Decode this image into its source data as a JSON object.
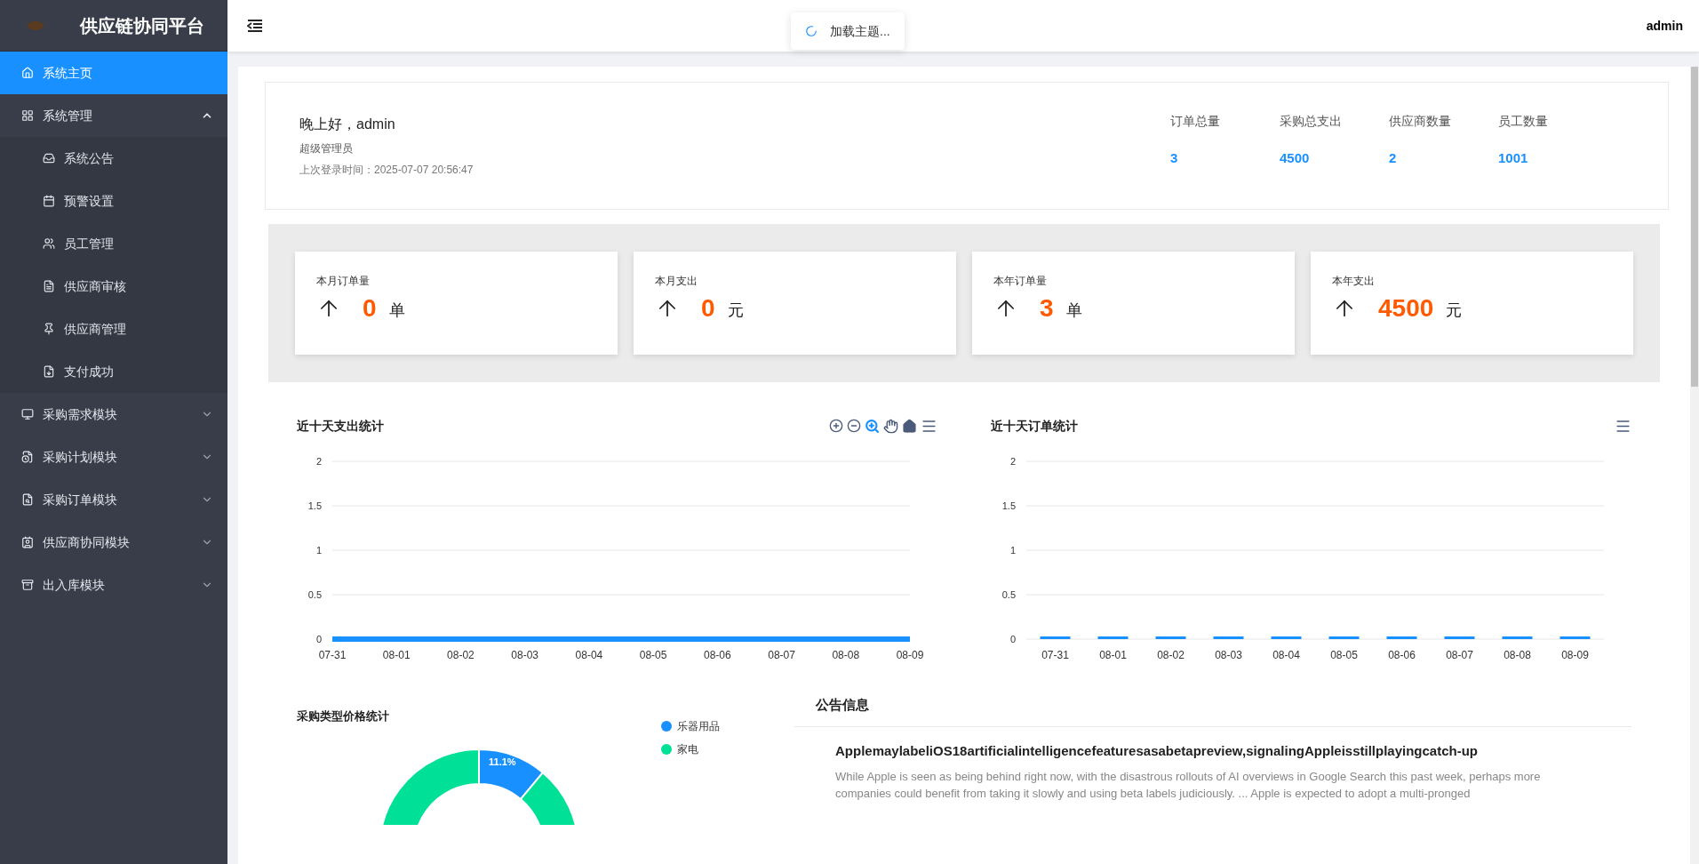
{
  "sidebar": {
    "title": "供应链协同平台",
    "items": [
      {
        "label": "系统主页",
        "kind": "item",
        "selected": true
      },
      {
        "label": "系统管理",
        "kind": "group",
        "selected": false,
        "expanded": true,
        "children": [
          {
            "label": "系统公告",
            "selected": false
          },
          {
            "label": "预警设置",
            "selected": false
          },
          {
            "label": "员工管理",
            "selected": false
          },
          {
            "label": "供应商审核",
            "selected": false
          },
          {
            "label": "供应商管理",
            "selected": false
          },
          {
            "label": "支付成功",
            "selected": false
          }
        ]
      },
      {
        "label": "采购需求模块",
        "kind": "group",
        "selected": false,
        "expanded": false
      },
      {
        "label": "采购计划模块",
        "kind": "group",
        "selected": false,
        "expanded": false
      },
      {
        "label": "采购订单模块",
        "kind": "group",
        "selected": false,
        "expanded": false
      },
      {
        "label": "供应商协同模块",
        "kind": "group",
        "selected": false,
        "expanded": false
      },
      {
        "label": "出入库模块",
        "kind": "group",
        "selected": false,
        "expanded": false
      }
    ]
  },
  "header": {
    "toast": "加载主题...",
    "user": "admin"
  },
  "welcome": {
    "greeting": "晚上好，admin",
    "role": "超级管理员",
    "last_login": "上次登录时间：2025-07-07 20:56:47",
    "stats": [
      {
        "label": "订单总量",
        "value": "3"
      },
      {
        "label": "采购总支出",
        "value": "4500"
      },
      {
        "label": "供应商数量",
        "value": "2"
      },
      {
        "label": "员工数量",
        "value": "1001"
      }
    ]
  },
  "cards": [
    {
      "label": "本月订单量",
      "value": "0",
      "unit": "单"
    },
    {
      "label": "本月支出",
      "value": "0",
      "unit": "元"
    },
    {
      "label": "本年订单量",
      "value": "3",
      "unit": "单"
    },
    {
      "label": "本年支出",
      "value": "4500",
      "unit": "元"
    }
  ],
  "expense_chart": {
    "chart_data": {
      "type": "line",
      "title": "近十天支出统计",
      "categories": [
        "07-31",
        "08-01",
        "08-02",
        "08-03",
        "08-04",
        "08-05",
        "08-06",
        "08-07",
        "08-08",
        "08-09"
      ],
      "series": [
        {
          "color": "#1890ff",
          "values": [
            0,
            0,
            0,
            0,
            0,
            0,
            0,
            0,
            0,
            0
          ]
        }
      ],
      "ylim": [
        0,
        2
      ],
      "yticks": [
        0,
        0.5,
        1,
        1.5,
        2
      ],
      "grid": true
    }
  },
  "order_chart": {
    "chart_data": {
      "type": "bar",
      "title": "近十天订单统计",
      "categories": [
        "07-31",
        "08-01",
        "08-02",
        "08-03",
        "08-04",
        "08-05",
        "08-06",
        "08-07",
        "08-08",
        "08-09"
      ],
      "series": [
        {
          "color": "#1890ff",
          "values": [
            0,
            0,
            0,
            0,
            0,
            0,
            0,
            0,
            0,
            0
          ]
        }
      ],
      "ylim": [
        0,
        2
      ],
      "yticks": [
        0,
        0.5,
        1,
        1.5,
        2
      ],
      "grid": true
    }
  },
  "type_chart": {
    "chart_data": {
      "type": "donut",
      "title": "采购类型价格统计",
      "categories": [
        "乐器用品",
        "家电"
      ],
      "series": [
        {
          "values": [
            11.1,
            88.9
          ]
        }
      ],
      "colors": [
        "#1890ff",
        "#00e096"
      ],
      "annotations": [
        {
          "text": "11.1%"
        }
      ]
    }
  },
  "notice": {
    "title": "公告信息",
    "article_title": "ApplemaylabeliOS18artificialintelligencefeaturesasabetapreview,signalingAppleisstillplayingcatch-up",
    "article_text": "While Apple is seen as being behind right now, with the disastrous rollouts of AI overviews in Google Search this past week, perhaps more companies could benefit from taking it slowly and using beta labels judiciously. ... Apple is expected to adopt a multi-pronged"
  }
}
